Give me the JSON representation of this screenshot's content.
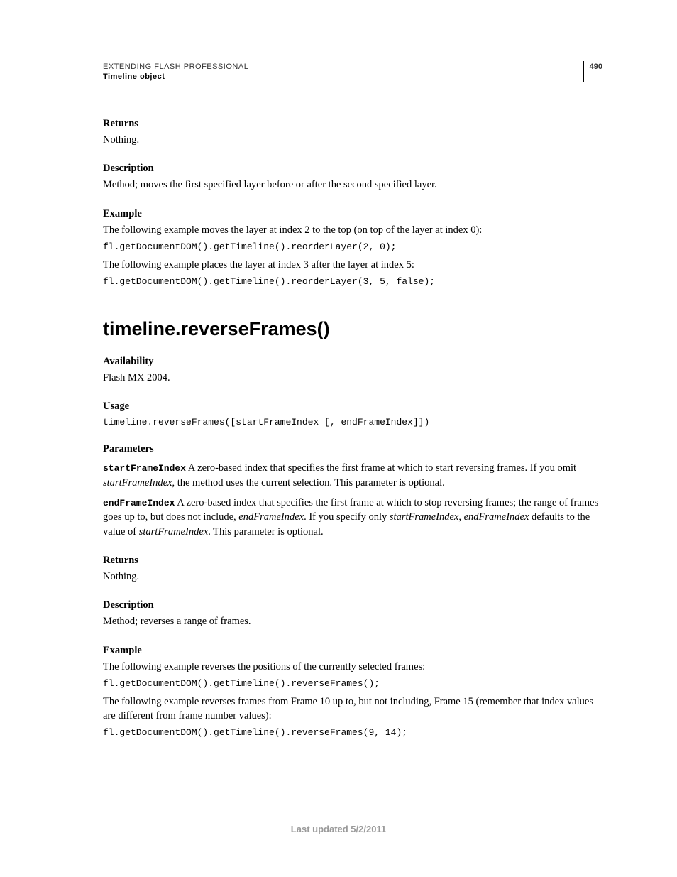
{
  "header": {
    "title": "EXTENDING FLASH PROFESSIONAL",
    "subtitle": "Timeline object",
    "page_number": "490"
  },
  "sec1": {
    "returns_label": "Returns",
    "returns_text": "Nothing.",
    "description_label": "Description",
    "description_text": "Method; moves the first specified layer before or after the second specified layer.",
    "example_label": "Example",
    "example_intro1": "The following example moves the layer at index 2 to the top (on top of the layer at index 0):",
    "example_code1": "fl.getDocumentDOM().getTimeline().reorderLayer(2, 0);",
    "example_intro2": "The following example places the layer at index 3 after the layer at index 5:",
    "example_code2": "fl.getDocumentDOM().getTimeline().reorderLayer(3, 5, false);"
  },
  "h1": "timeline.reverseFrames()",
  "sec2": {
    "availability_label": "Availability",
    "availability_text": "Flash MX 2004.",
    "usage_label": "Usage",
    "usage_code": "timeline.reverseFrames([startFrameIndex [, endFrameIndex]])",
    "parameters_label": "Parameters",
    "param1_code": "startFrameIndex",
    "param1_text_a": "  A zero-based index that specifies the first frame at which to start reversing frames. If you omit ",
    "param1_ital": "startFrameIndex",
    "param1_text_b": ", the method uses the current selection. This parameter is optional.",
    "param2_code": "endFrameIndex",
    "param2_text_a": "  A zero-based index that specifies the first frame at which to stop reversing frames; the range of frames goes up to, but does not include, ",
    "param2_ital1": "endFrameIndex",
    "param2_text_b": ". If you specify only ",
    "param2_ital2": "startFrameIndex",
    "param2_text_c": ", ",
    "param2_ital3": "endFrameIndex",
    "param2_text_d": " defaults to the value of ",
    "param2_ital4": "startFrameIndex",
    "param2_text_e": ". This parameter is optional.",
    "returns_label": "Returns",
    "returns_text": "Nothing.",
    "description_label": "Description",
    "description_text": "Method; reverses a range of frames.",
    "example_label": "Example",
    "example_intro1": "The following example reverses the positions of the currently selected frames:",
    "example_code1": "fl.getDocumentDOM().getTimeline().reverseFrames();",
    "example_intro2": "The following example reverses frames from Frame 10 up to, but not including, Frame 15 (remember that index values are different from frame number values):",
    "example_code2": "fl.getDocumentDOM().getTimeline().reverseFrames(9, 14);"
  },
  "footer": "Last updated 5/2/2011"
}
